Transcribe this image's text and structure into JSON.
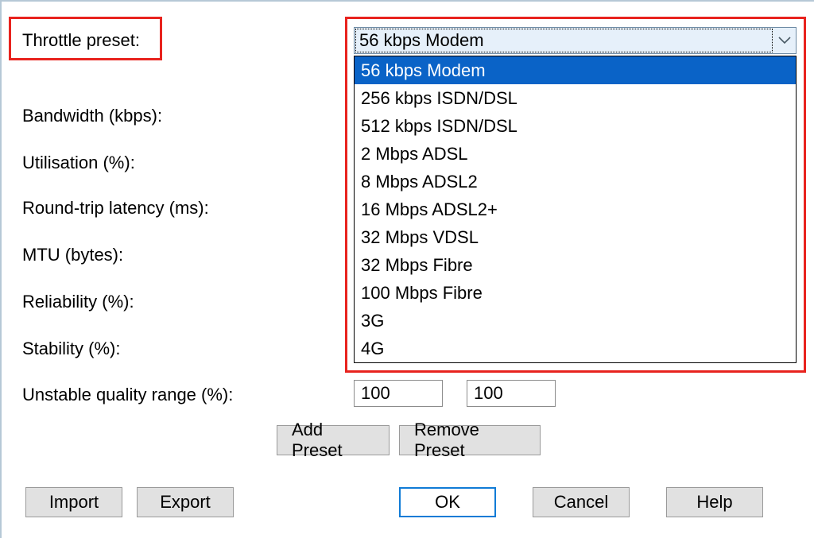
{
  "labels": {
    "throttle_preset": "Throttle preset:",
    "bandwidth": "Bandwidth (kbps):",
    "utilisation": "Utilisation (%):",
    "latency": "Round-trip latency (ms):",
    "mtu": "MTU (bytes):",
    "reliability": "Reliability (%):",
    "stability": "Stability (%):",
    "unstable_range": "Unstable quality range (%):"
  },
  "combo": {
    "selected": "56 kbps Modem",
    "options": [
      "56 kbps Modem",
      "256 kbps ISDN/DSL",
      "512 kbps ISDN/DSL",
      "2 Mbps ADSL",
      "8 Mbps ADSL2",
      "16 Mbps ADSL2+",
      "32 Mbps VDSL",
      "32 Mbps Fibre",
      "100 Mbps Fibre",
      "3G",
      "4G"
    ],
    "selected_index": 0
  },
  "unstable_range": {
    "a": "100",
    "b": "100"
  },
  "buttons": {
    "add_preset": "Add Preset",
    "remove_preset": "Remove Preset",
    "import": "Import",
    "export": "Export",
    "ok": "OK",
    "cancel": "Cancel",
    "help": "Help"
  }
}
